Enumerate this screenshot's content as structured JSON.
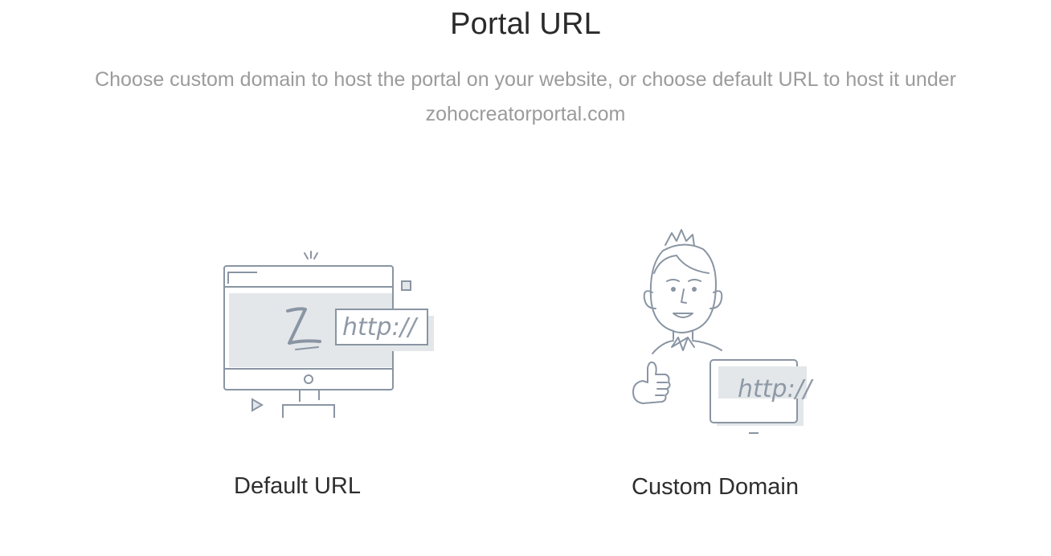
{
  "header": {
    "title": "Portal URL",
    "subtitle": "Choose custom domain to host the portal on your website, or choose default URL to host it under zohocreatorportal.com"
  },
  "options": [
    {
      "label": "Default URL",
      "illustration_icon": "monitor-url-illustration-icon",
      "illustration_text": "http://"
    },
    {
      "label": "Custom Domain",
      "illustration_icon": "person-thumbs-up-illustration-icon",
      "illustration_text": "http://"
    }
  ],
  "colors": {
    "title": "#2a2a2a",
    "subtitle": "#9b9b9b",
    "illustration_stroke": "#8a95a3",
    "illustration_fill": "#e3e7ea"
  }
}
